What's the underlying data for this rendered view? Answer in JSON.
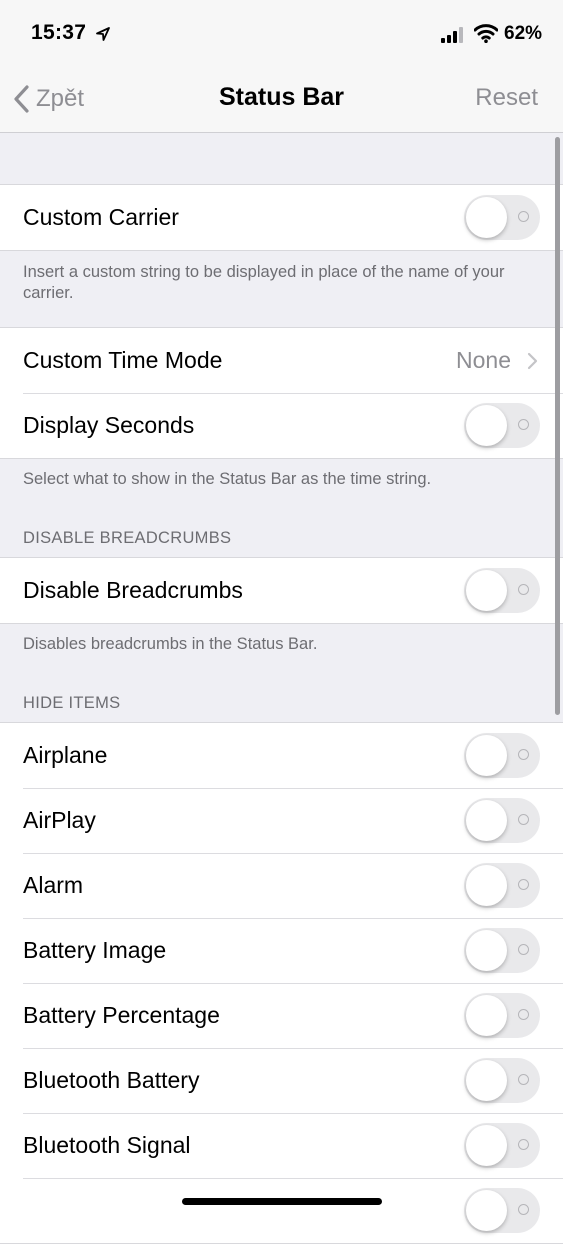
{
  "status_bar": {
    "time": "15:37",
    "battery": "62%",
    "icons": [
      "location-arrow-icon",
      "cellular-signal-icon",
      "wifi-icon"
    ]
  },
  "nav": {
    "back_label": "Zpět",
    "title": "Status Bar",
    "reset_label": "Reset"
  },
  "section1": {
    "custom_carrier_label": "Custom Carrier",
    "custom_carrier_on": false,
    "footer": "Insert a custom string to be displayed in place of the name of your carrier."
  },
  "section2": {
    "custom_time_mode_label": "Custom Time Mode",
    "custom_time_mode_value": "None",
    "display_seconds_label": "Display Seconds",
    "display_seconds_on": false,
    "footer": "Select what to show in the Status Bar as the time string."
  },
  "section3": {
    "header": "DISABLE BREADCRUMBS",
    "disable_breadcrumbs_label": "Disable Breadcrumbs",
    "disable_breadcrumbs_on": false,
    "footer": "Disables breadcrumbs in the Status Bar."
  },
  "section4": {
    "header": "HIDE ITEMS",
    "items": [
      {
        "label": "Airplane",
        "on": false
      },
      {
        "label": "AirPlay",
        "on": false
      },
      {
        "label": "Alarm",
        "on": false
      },
      {
        "label": "Battery Image",
        "on": false
      },
      {
        "label": "Battery Percentage",
        "on": false
      },
      {
        "label": "Bluetooth Battery",
        "on": false
      },
      {
        "label": "Bluetooth Signal",
        "on": false
      },
      {
        "label": "",
        "on": false
      }
    ]
  },
  "colors": {
    "toggle_off": "#e9e9eb",
    "secondary_text": "#8e8e93",
    "background": "#efeff4"
  }
}
